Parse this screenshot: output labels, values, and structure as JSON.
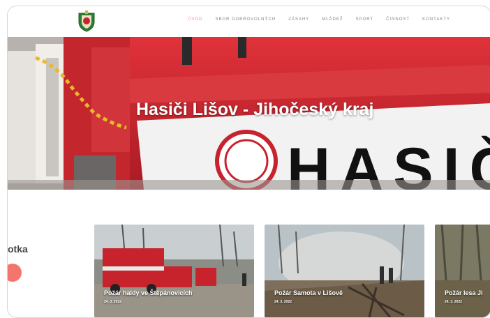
{
  "nav": {
    "items": [
      "Úvod",
      "Sbor dobrovolných",
      "Zásahy",
      "Mládež",
      "Sport",
      "Činnost",
      "Kontakty"
    ],
    "active_index": 0
  },
  "hero": {
    "title": "Hasiči Lišov - Jihočeský kraj",
    "vehicle_lettering": "HASIČ"
  },
  "section": {
    "partial_title": "otka"
  },
  "news": [
    {
      "title": "Požár haldy ve Štěpánovicích",
      "date": "24. 3. 2022"
    },
    {
      "title": "Požár Samota v Lišově",
      "date": "24. 3. 2022"
    },
    {
      "title": "Požár lesa Ji",
      "date": "24. 3. 2022"
    }
  ],
  "colors": {
    "accent": "#f3756c",
    "nav_active": "#f2908a",
    "truck_red": "#c7232d"
  },
  "icons": {
    "logo": "fire-brigade-crest-icon"
  }
}
